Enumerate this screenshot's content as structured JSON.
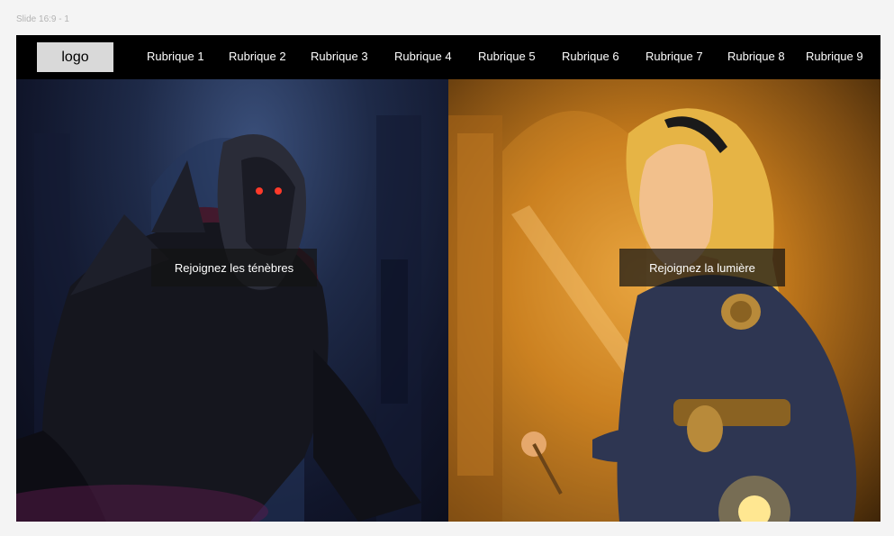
{
  "frame": {
    "label": "Slide 16:9 - 1"
  },
  "nav": {
    "logo": "logo",
    "items": [
      "Rubrique 1",
      "Rubrique 2",
      "Rubrique 3",
      "Rubrique 4",
      "Rubrique 5",
      "Rubrique 6",
      "Rubrique 7",
      "Rubrique 8",
      "Rubrique 9"
    ]
  },
  "hero": {
    "left_cta": "Rejoignez les ténèbres",
    "right_cta": "Rejoignez la lumière"
  },
  "colors": {
    "nav_bg": "#000000",
    "logo_bg": "#d9d9d9",
    "dark_theme": "#1e2a48",
    "light_theme": "#e8a43a"
  }
}
